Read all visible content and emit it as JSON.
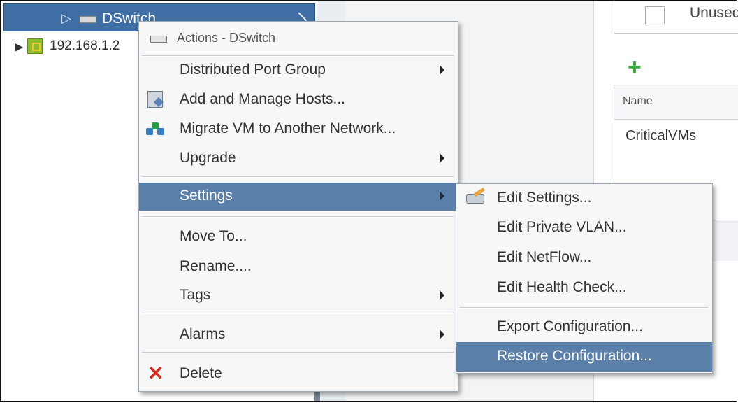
{
  "tree": {
    "selected_label": "DSwitch",
    "datacenter_label": "192.168.1.2"
  },
  "right_panel": {
    "unused_label": "Unused",
    "grid_header": "Name",
    "grid_rows": [
      "CriticalVMs"
    ]
  },
  "menu": {
    "title": "Actions - DSwitch",
    "items": [
      {
        "label": "Distributed Port Group",
        "icon": "none",
        "submenu": true
      },
      {
        "label": "Add and Manage Hosts...",
        "icon": "hosts-icon",
        "submenu": false
      },
      {
        "label": "Migrate VM to Another Network...",
        "icon": "migrate-icon",
        "submenu": false
      },
      {
        "label": "Upgrade",
        "icon": "none",
        "submenu": true
      },
      {
        "label": "Settings",
        "icon": "none",
        "submenu": true,
        "highlighted": true
      },
      {
        "label": "Move To...",
        "icon": "none",
        "submenu": false
      },
      {
        "label": "Rename....",
        "icon": "none",
        "submenu": false
      },
      {
        "label": "Tags",
        "icon": "none",
        "submenu": true
      },
      {
        "label": "Alarms",
        "icon": "none",
        "submenu": true
      },
      {
        "label": "Delete",
        "icon": "delete-icon",
        "submenu": false
      }
    ]
  },
  "submenu": {
    "items": [
      {
        "label": "Edit Settings...",
        "icon": "edit-settings-icon"
      },
      {
        "label": "Edit Private VLAN..."
      },
      {
        "label": "Edit NetFlow..."
      },
      {
        "label": "Edit Health Check..."
      },
      {
        "label": "Export Configuration..."
      },
      {
        "label": "Restore Configuration...",
        "highlighted": true
      }
    ]
  },
  "colors": {
    "selection": "#3e6ea3",
    "menu_highlight": "#5a7fa9",
    "menu_bg": "#f7f7f7",
    "delete_red": "#d12b1f",
    "add_green": "#3aa83a"
  }
}
